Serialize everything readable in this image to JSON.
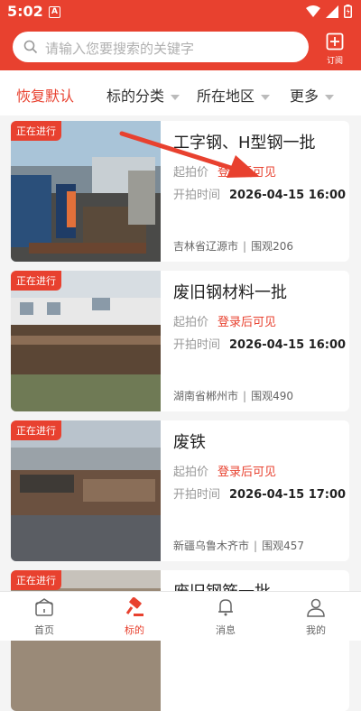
{
  "status": {
    "time": "5:02",
    "notif_letter": "A"
  },
  "search": {
    "placeholder": "请输入您要搜索的关键字"
  },
  "subscribe": {
    "label": "订阅"
  },
  "filters": [
    {
      "label": "恢复默认"
    },
    {
      "label": "标的分类"
    },
    {
      "label": "所在地区"
    },
    {
      "label": "更多"
    }
  ],
  "labels": {
    "start_price": "起拍价",
    "start_time": "开拍时间",
    "views_prefix": "围观"
  },
  "listings": [
    {
      "badge": "正在进行",
      "title": "工字钢、H型钢一批",
      "price": "登录后可见",
      "time": "2026-04-15 16:00",
      "location": "吉林省辽源市",
      "views": "206"
    },
    {
      "badge": "正在进行",
      "title": "废旧钢材料一批",
      "price": "登录后可见",
      "time": "2026-04-15 16:00",
      "location": "湖南省郴州市",
      "views": "490"
    },
    {
      "badge": "正在进行",
      "title": "废铁",
      "price": "登录后可见",
      "time": "2026-04-15 17:00",
      "location": "新疆乌鲁木齐市",
      "views": "457"
    },
    {
      "badge": "正在进行",
      "title": "废旧钢筋一批"
    }
  ],
  "tabbar": [
    {
      "label": "首页"
    },
    {
      "label": "标的"
    },
    {
      "label": "消息"
    },
    {
      "label": "我的"
    }
  ],
  "colors": {
    "brand": "#e8412f"
  }
}
